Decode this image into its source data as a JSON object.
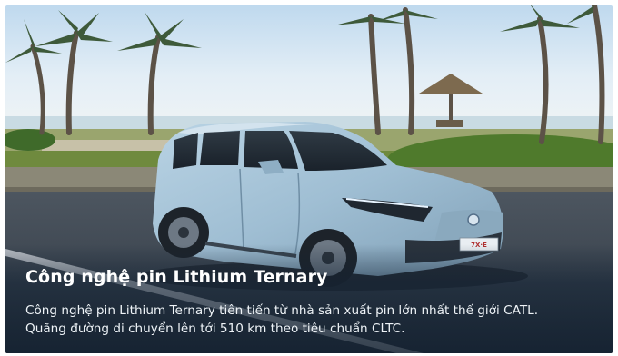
{
  "banner": {
    "image": {
      "subject": "light-blue-electric-mpv-car",
      "setting": "beach-road-with-palm-trees",
      "plate_text": "7X·E"
    },
    "title": "Công nghệ pin Lithium Ternary",
    "description_lines": [
      "Công nghệ pin Lithium Ternary tiên tiến từ nhà sản xuất pin lớn nhất thế giới CATL.",
      "Quãng đường di chuyển lên tới 510 km theo tiêu chuẩn CLTC."
    ]
  }
}
